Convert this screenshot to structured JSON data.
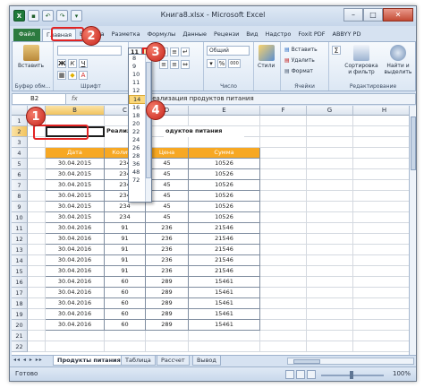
{
  "window": {
    "title": "Книга8.xlsx - Microsoft Excel",
    "qat_icons": [
      "excel-icon",
      "save-icon",
      "undo-icon",
      "redo-icon",
      "customize-icon"
    ],
    "controls": {
      "minimize": "–",
      "maximize": "□",
      "close": "✕"
    }
  },
  "tabs": [
    "Файл",
    "Главная",
    "Вставка",
    "Разметка",
    "Формулы",
    "Данные",
    "Рецензи",
    "Вид",
    "Надстро",
    "Foxit PDF",
    "ABBYY PD"
  ],
  "ribbon": {
    "paste_label": "Вставить",
    "clipboard_label": "Буфер обм...",
    "font_label": "Шрифт",
    "alignment_label": "",
    "number_format": "Общий",
    "number_label": "Число",
    "styles_label": "Стили",
    "insert_label": "Вставить",
    "delete_label": "Удалить",
    "format_label": "Формат",
    "cells_label": "Ячейки",
    "sort_label": "Сортировка и фильтр",
    "find_label": "Найти и выделить",
    "editing_label": "Редактирование",
    "bold": "Ж",
    "italic": "К",
    "underline": "Ч",
    "percent": "%",
    "thousands": "000",
    "currency": "▾",
    "sigma": "Σ"
  },
  "formula_bar": {
    "cell_ref": "B2",
    "fx": "fx",
    "content": "Реализация продуктов питания"
  },
  "columns": [
    "A",
    "B",
    "C",
    "D",
    "E",
    "F",
    "G",
    "H"
  ],
  "rows": [
    "1",
    "2",
    "3",
    "4",
    "5",
    "6",
    "7",
    "8",
    "9",
    "10",
    "11",
    "12",
    "13",
    "14",
    "15",
    "16",
    "17",
    "18",
    "19",
    "20",
    "21",
    "22"
  ],
  "sheet": {
    "title_prefix": "Реализа",
    "title_suffix": "одуктов питания",
    "headers": [
      "Дата",
      "Количес",
      "Цена",
      "Сумма"
    ],
    "data": [
      [
        "30.04.2015",
        "234",
        "45",
        "10526"
      ],
      [
        "30.04.2015",
        "234",
        "45",
        "10526"
      ],
      [
        "30.04.2015",
        "234",
        "45",
        "10526"
      ],
      [
        "30.04.2015",
        "234",
        "45",
        "10526"
      ],
      [
        "30.04.2015",
        "234",
        "45",
        "10526"
      ],
      [
        "30.04.2015",
        "234",
        "45",
        "10526"
      ],
      [
        "30.04.2016",
        "91",
        "236",
        "21546"
      ],
      [
        "30.04.2016",
        "91",
        "236",
        "21546"
      ],
      [
        "30.04.2016",
        "91",
        "236",
        "21546"
      ],
      [
        "30.04.2016",
        "91",
        "236",
        "21546"
      ],
      [
        "30.04.2016",
        "91",
        "236",
        "21546"
      ],
      [
        "30.04.2016",
        "60",
        "289",
        "15461"
      ],
      [
        "30.04.2016",
        "60",
        "289",
        "15461"
      ],
      [
        "30.04.2016",
        "60",
        "289",
        "15461"
      ],
      [
        "30.04.2016",
        "60",
        "289",
        "15461"
      ],
      [
        "30.04.2016",
        "60",
        "289",
        "15461"
      ]
    ]
  },
  "font_sizes": [
    "8",
    "9",
    "10",
    "11",
    "12",
    "14",
    "16",
    "18",
    "20",
    "22",
    "24",
    "26",
    "28",
    "36",
    "48",
    "72"
  ],
  "font_size_current": "11",
  "sheet_tabs": [
    "Продукты питания",
    "Таблица",
    "Рассчет",
    "Вывод"
  ],
  "status": {
    "ready": "Готово",
    "zoom": "100%"
  },
  "callouts": [
    "1",
    "2",
    "3",
    "4"
  ],
  "colors": {
    "header_orange": "#f7a823",
    "file_tab_green": "#2c7a3f",
    "callout_red": "#d0301f"
  }
}
